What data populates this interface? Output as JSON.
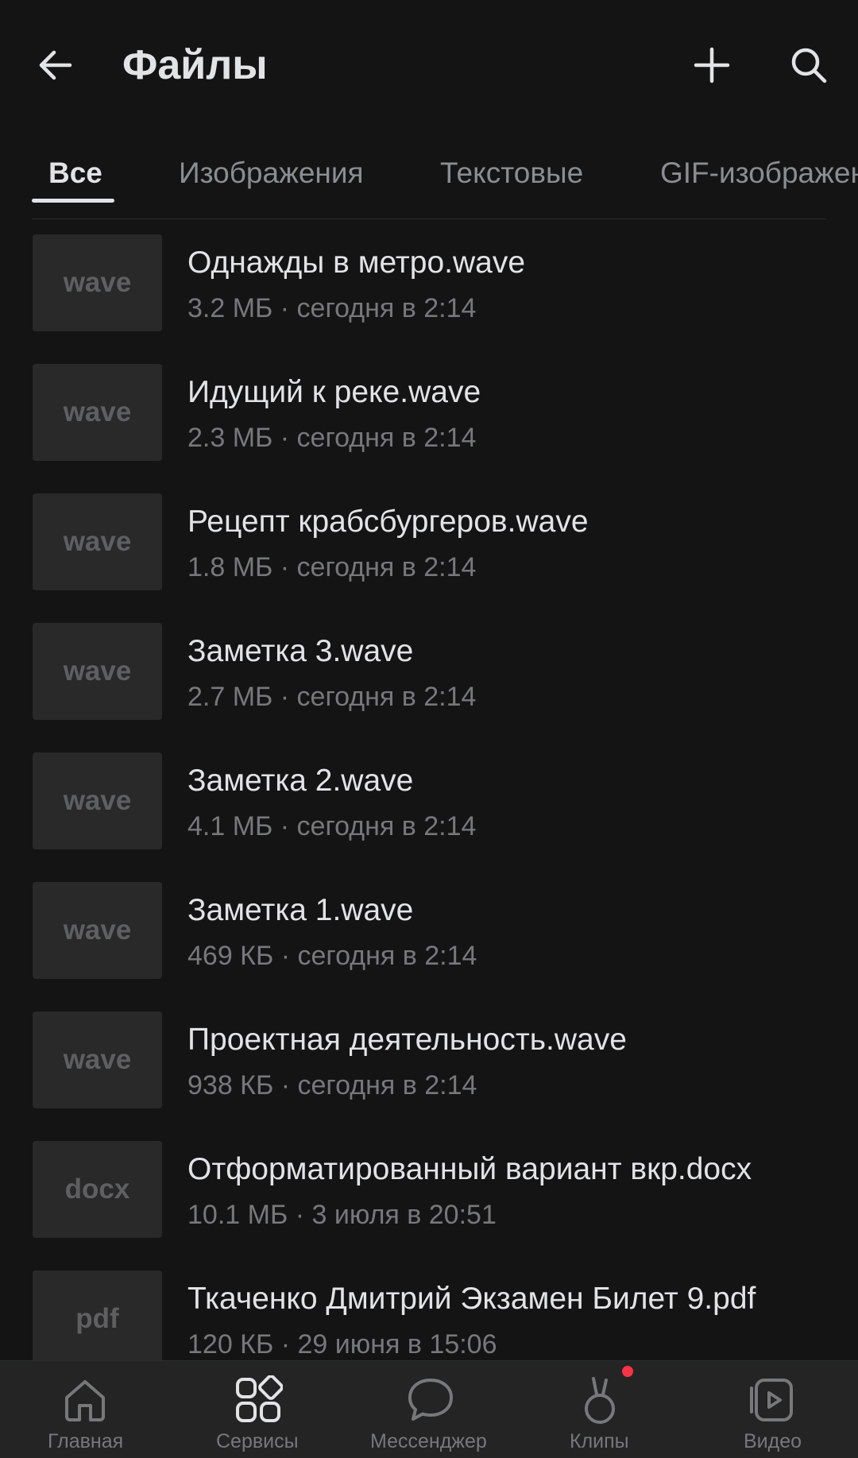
{
  "header": {
    "title": "Файлы",
    "back_icon": "arrow-left-icon",
    "add_icon": "plus-icon",
    "search_icon": "search-icon"
  },
  "tabs": [
    {
      "label": "Все",
      "active": true
    },
    {
      "label": "Изображения",
      "active": false
    },
    {
      "label": "Текстовые",
      "active": false
    },
    {
      "label": "GIF-изображения",
      "active": false
    }
  ],
  "files": [
    {
      "ext": "wave",
      "name": "Однажды в метро.wave",
      "meta": "3.2 МБ · сегодня в 2:14"
    },
    {
      "ext": "wave",
      "name": "Идущий к реке.wave",
      "meta": "2.3 МБ · сегодня в 2:14"
    },
    {
      "ext": "wave",
      "name": "Рецепт крабсбургеров.wave",
      "meta": "1.8 МБ · сегодня в 2:14"
    },
    {
      "ext": "wave",
      "name": "Заметка 3.wave",
      "meta": "2.7 МБ · сегодня в 2:14"
    },
    {
      "ext": "wave",
      "name": "Заметка 2.wave",
      "meta": "4.1 МБ · сегодня в 2:14"
    },
    {
      "ext": "wave",
      "name": "Заметка 1.wave",
      "meta": "469 КБ · сегодня в 2:14"
    },
    {
      "ext": "wave",
      "name": "Проектная деятельность.wave",
      "meta": "938 КБ · сегодня в 2:14"
    },
    {
      "ext": "docx",
      "name": "Отформатированный вариант вкр.docx",
      "meta": "10.1 МБ · 3 июля в 20:51"
    },
    {
      "ext": "pdf",
      "name": "Ткаченко Дмитрий Экзамен Билет 9.pdf",
      "meta": "120 КБ · 29 июня в 15:06"
    }
  ],
  "bottom_nav": [
    {
      "label": "Главная",
      "icon": "home-icon",
      "active": false
    },
    {
      "label": "Сервисы",
      "icon": "services-icon",
      "active": true
    },
    {
      "label": "Мессенджер",
      "icon": "messenger-icon",
      "active": false
    },
    {
      "label": "Клипы",
      "icon": "clips-icon",
      "active": false,
      "badge": true
    },
    {
      "label": "Видео",
      "icon": "video-icon",
      "active": false
    }
  ],
  "colors": {
    "background": "#141414",
    "text_primary": "#e1e3e6",
    "text_secondary": "#76787a",
    "thumb_bg": "#292929",
    "nav_bg": "#242424",
    "badge": "#ff3347"
  }
}
